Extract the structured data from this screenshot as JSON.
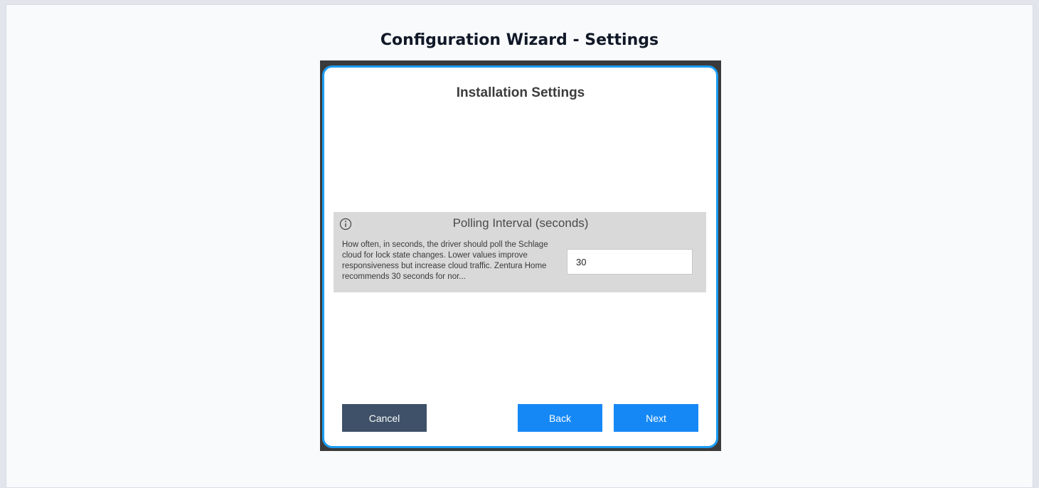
{
  "page": {
    "title": "Configuration Wizard - Settings"
  },
  "dialog": {
    "title": "Installation Settings",
    "setting": {
      "title": "Polling Interval (seconds)",
      "info_icon": "info-icon",
      "description": "How often, in seconds, the driver should poll the Schlage cloud for lock state changes. Lower values improve responsiveness but increase cloud traffic. Zentura Home recommends 30 seconds for nor...",
      "value": "30"
    },
    "buttons": {
      "cancel": "Cancel",
      "back": "Back",
      "next": "Next"
    }
  },
  "colors": {
    "accent": "#1a9bf0",
    "primary_button": "#1688f5",
    "cancel_button": "#3e5168",
    "panel_background": "#d9d9d9"
  }
}
